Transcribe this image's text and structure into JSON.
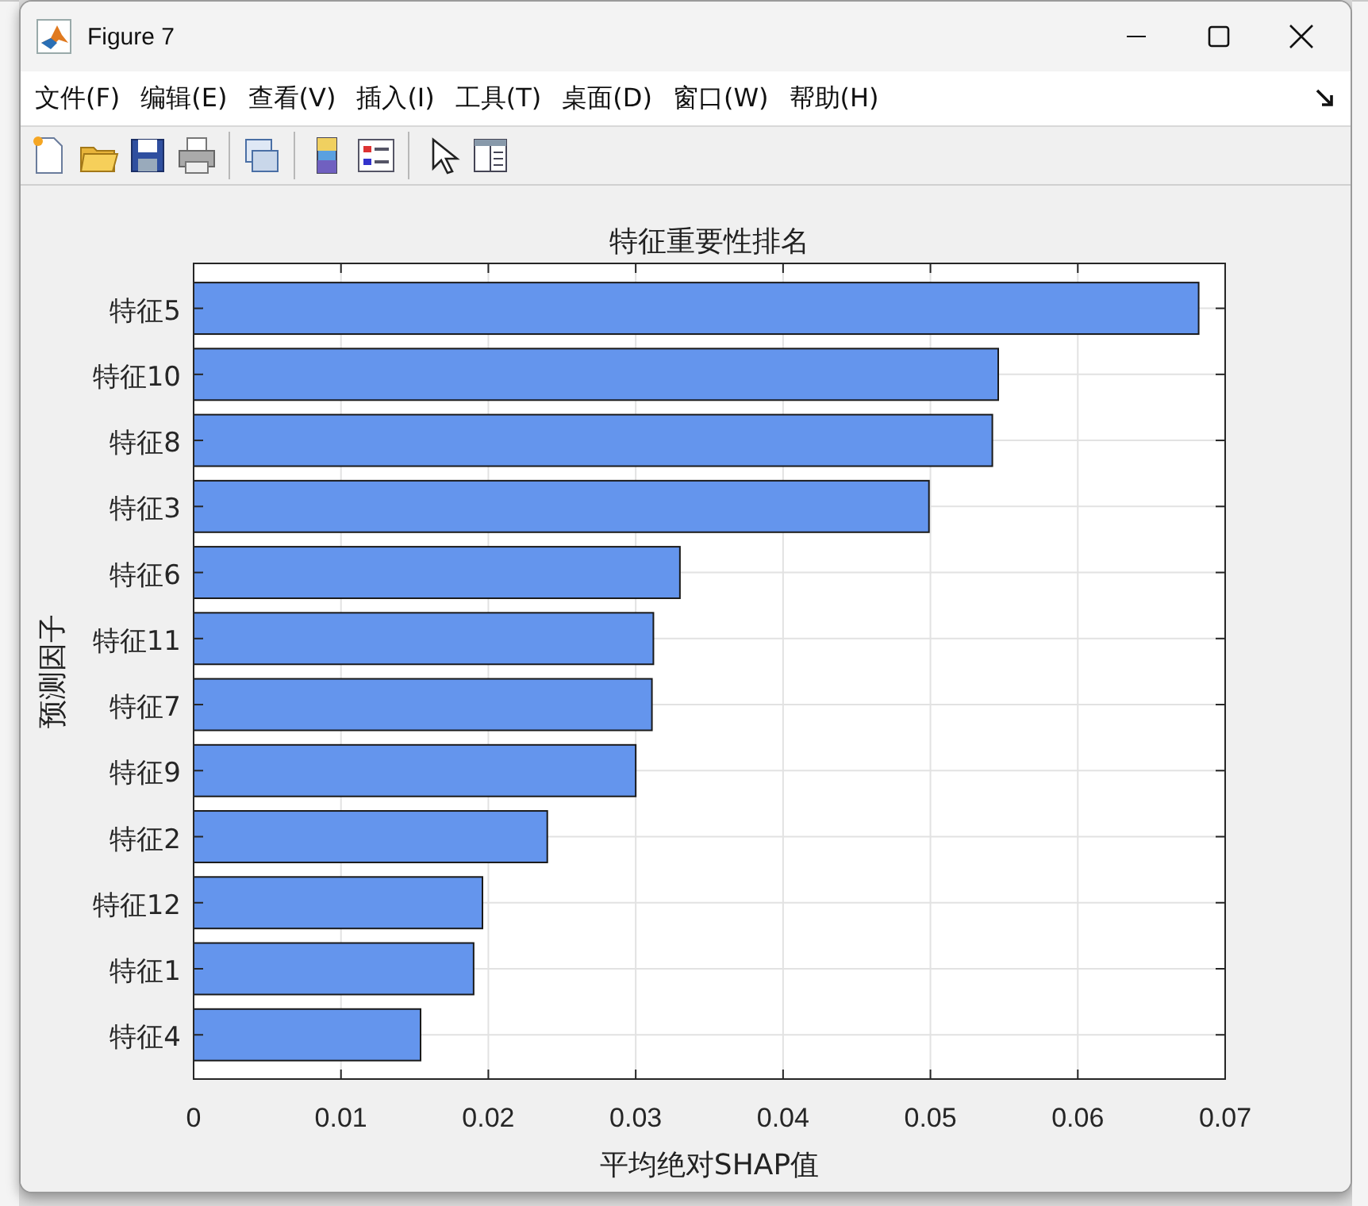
{
  "window": {
    "title": "Figure 7"
  },
  "menu": [
    {
      "label": "文件(F)"
    },
    {
      "label": "编辑(E)"
    },
    {
      "label": "查看(V)"
    },
    {
      "label": "插入(I)"
    },
    {
      "label": "工具(T)"
    },
    {
      "label": "桌面(D)"
    },
    {
      "label": "窗口(W)"
    },
    {
      "label": "帮助(H)"
    }
  ],
  "figure": {
    "chart_data": {
      "type": "bar",
      "orientation": "horizontal",
      "title": "特征重要性排名",
      "xlabel": "平均绝对SHAP值",
      "ylabel": "预测因子",
      "categories": [
        "特征5",
        "特征10",
        "特征8",
        "特征3",
        "特征6",
        "特征11",
        "特征7",
        "特征9",
        "特征2",
        "特征12",
        "特征1",
        "特征4"
      ],
      "series": [
        {
          "color": "#6495ed",
          "values": [
            0.0682,
            0.0546,
            0.0542,
            0.0499,
            0.033,
            0.0312,
            0.0311,
            0.03,
            0.024,
            0.0196,
            0.019,
            0.0154
          ]
        }
      ],
      "grid": true,
      "xlim": [
        0,
        0.07
      ],
      "xticks": [
        0,
        0.01,
        0.02,
        0.03,
        0.04,
        0.05,
        0.06,
        0.07
      ]
    }
  }
}
